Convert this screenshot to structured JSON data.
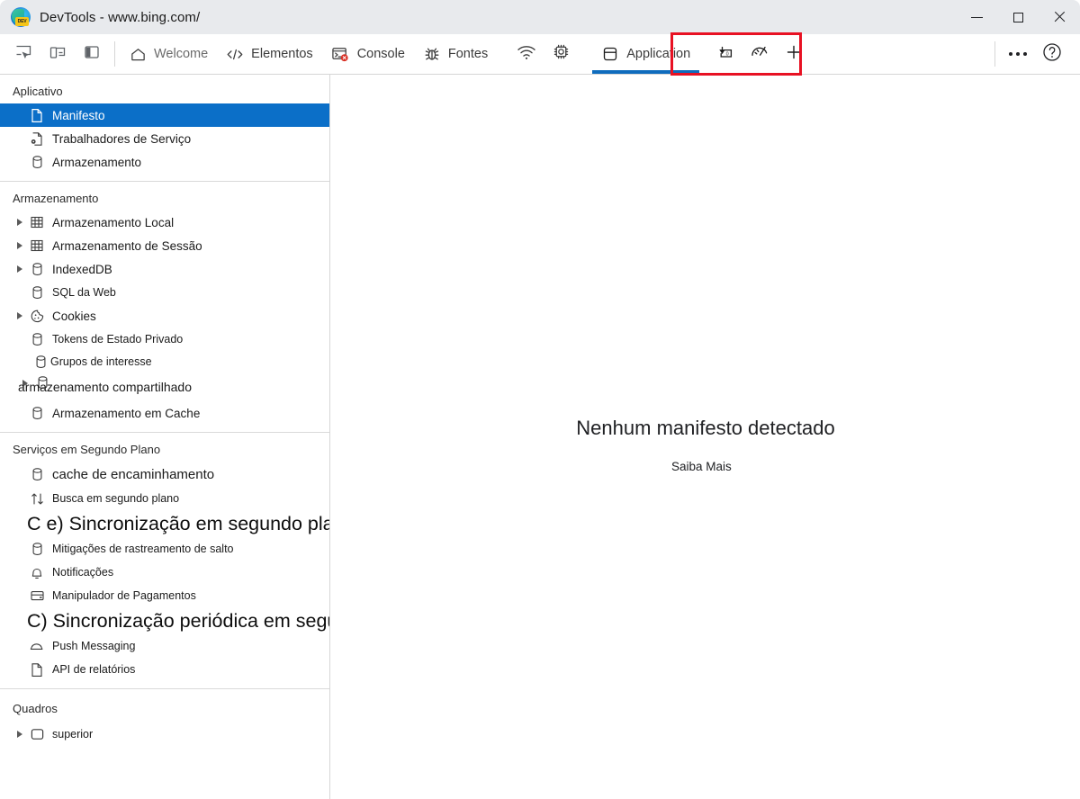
{
  "window": {
    "title": "DevTools - www.bing.com/",
    "app_icon": "edge-dev-logo",
    "badge_text": "DEV",
    "minimize_label": "Minimizar",
    "maximize_label": "Maximizar",
    "close_label": "Fechar"
  },
  "toolbar": {
    "left_icons": [
      {
        "name": "inspect-element-icon",
        "title": "Inspecionar elemento"
      },
      {
        "name": "device-emulation-icon",
        "title": "Alternar emulação de dispositivo"
      },
      {
        "name": "dock-side-icon",
        "title": "Posição de encaixe"
      }
    ],
    "tabs": [
      {
        "label": "Welcome",
        "icon": "home-icon",
        "active": false
      },
      {
        "label": "Elementos",
        "icon": "code-brackets-icon",
        "active": false
      },
      {
        "label": "Console",
        "icon": "console-error-icon",
        "active": false
      },
      {
        "label": "Fontes",
        "icon": "bug-icon",
        "active": false
      }
    ],
    "icon_tabs": [
      {
        "name": "network-icon",
        "title": "Rede"
      },
      {
        "name": "performance-chip-icon",
        "title": "Desempenho"
      }
    ],
    "active_tab": {
      "label": "Application",
      "icon": "application-storage-icon",
      "highlighted": true
    },
    "trailing_icons": [
      {
        "name": "memory-inspector-icon",
        "title": "Inspetor de memória"
      },
      {
        "name": "performance-meter-icon",
        "title": "Medidor de desempenho"
      },
      {
        "name": "add-tab-icon",
        "title": "Mais ferramentas"
      }
    ],
    "right_icons": [
      {
        "name": "more-options-icon",
        "title": "Personalizar e controlar o DevTools"
      },
      {
        "name": "help-icon",
        "title": "Ajuda"
      }
    ],
    "highlight_color": "#e81123",
    "active_underline_color": "#0f6cbd"
  },
  "sidebar": {
    "selected_color": "#0b6fc8",
    "groups": [
      {
        "title": "Aplicativo",
        "items": [
          {
            "label": "Manifesto",
            "icon": "document-icon",
            "selected": true,
            "expandable": false
          },
          {
            "label": "Trabalhadores de Serviço",
            "icon": "service-worker-icon",
            "selected": false,
            "expandable": false
          },
          {
            "label": "Armazenamento",
            "icon": "database-icon",
            "selected": false,
            "expandable": false
          }
        ]
      },
      {
        "title": "Armazenamento",
        "items": [
          {
            "label": "Armazenamento Local",
            "icon": "table-grid-icon",
            "selected": false,
            "expandable": true
          },
          {
            "label": "Armazenamento de Sessão",
            "icon": "table-grid-icon",
            "selected": false,
            "expandable": true
          },
          {
            "label": "IndexedDB",
            "icon": "database-icon",
            "selected": false,
            "expandable": true
          },
          {
            "label": "SQL da Web",
            "icon": "database-icon",
            "selected": false,
            "expandable": false
          },
          {
            "label": "Cookies",
            "icon": "cookie-icon",
            "selected": false,
            "expandable": true
          },
          {
            "label": "Tokens de Estado Privado",
            "icon": "database-icon",
            "selected": false,
            "expandable": false
          },
          {
            "label": "Grupos de interesse",
            "icon": "database-icon",
            "selected": false,
            "expandable": false,
            "style": "overlap-a"
          },
          {
            "label": "armazenamento compartilhado",
            "icon": "database-icon",
            "selected": false,
            "expandable": true,
            "style": "overlap-b"
          },
          {
            "label": "Armazenamento em Cache",
            "icon": "database-icon",
            "selected": false,
            "expandable": false
          }
        ]
      },
      {
        "title": "Serviços em Segundo Plano",
        "items": [
          {
            "label": "cache de encaminhamento",
            "icon": "database-icon",
            "selected": false,
            "expandable": false
          },
          {
            "label": "Busca em segundo plano",
            "icon": "up-down-arrows-icon",
            "selected": false,
            "expandable": false
          },
          {
            "label": "C e) Sincronização em segundo plano",
            "icon": "sync-icon",
            "selected": false,
            "expandable": false,
            "style": "big"
          },
          {
            "label": "Mitigações de rastreamento de salto",
            "icon": "database-icon",
            "selected": false,
            "expandable": false
          },
          {
            "label": "Notificações",
            "icon": "bell-icon",
            "selected": false,
            "expandable": false
          },
          {
            "label": "Manipulador de Pagamentos",
            "icon": "payment-card-icon",
            "selected": false,
            "expandable": false
          },
          {
            "label": "C) Sincronização periódica em segundo plano",
            "icon": "sync-icon",
            "selected": false,
            "expandable": false,
            "style": "big"
          },
          {
            "label": "Push Messaging",
            "icon": "cloud-icon",
            "selected": false,
            "expandable": false
          },
          {
            "label": "API de relatórios",
            "icon": "document-icon",
            "selected": false,
            "expandable": false
          }
        ]
      },
      {
        "title": "Quadros",
        "items": [
          {
            "label": "superior",
            "icon": "frame-icon",
            "selected": false,
            "expandable": true
          }
        ]
      }
    ]
  },
  "main": {
    "empty_title": "Nenhum manifesto detectado",
    "learn_more_label": "Saiba Mais"
  }
}
